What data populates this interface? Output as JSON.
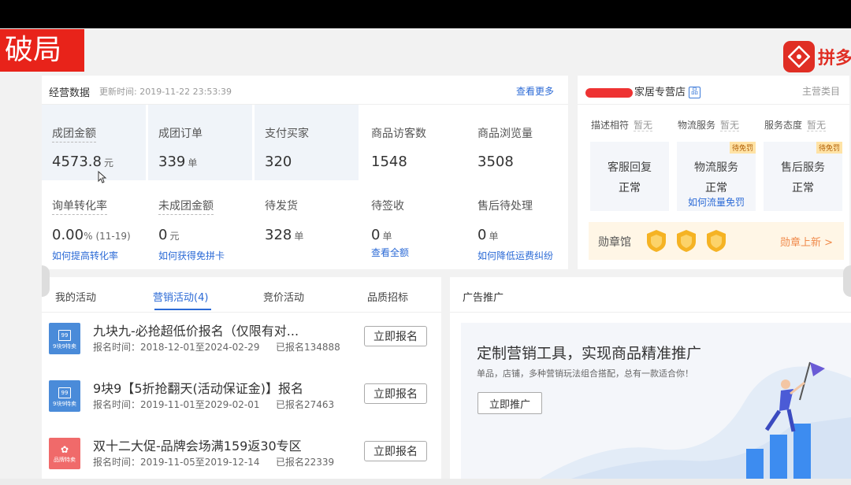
{
  "brand": {
    "label": "破局"
  },
  "logo": {
    "text": "拼多"
  },
  "ops": {
    "title": "经营数据",
    "updated": "更新时间: 2019-11-22 23:53:39",
    "more": "查看更多",
    "row1": [
      {
        "label": "成团金额",
        "value": "4573.8",
        "unit": "元"
      },
      {
        "label": "成团订单",
        "value": "339",
        "unit": "单"
      },
      {
        "label": "支付买家",
        "value": "320",
        "unit": ""
      },
      {
        "label": "商品访客数",
        "value": "1548",
        "unit": ""
      },
      {
        "label": "商品浏览量",
        "value": "3508",
        "unit": ""
      }
    ],
    "row2": [
      {
        "label": "询单转化率",
        "value": "0.00",
        "unit": "%",
        "extra": "(11-19)",
        "link": "如何提高转化率"
      },
      {
        "label": "未成团金额",
        "value": "0",
        "unit": "元",
        "link": "如何获得免拼卡"
      },
      {
        "label": "待发货",
        "value": "328",
        "unit": "单",
        "link": ""
      },
      {
        "label": "待签收",
        "value": "0",
        "unit": "单",
        "link": "查看全额"
      },
      {
        "label": "售后待处理",
        "value": "0",
        "unit": "单",
        "link": "如何降低运费纠纷"
      }
    ]
  },
  "shop": {
    "name": "家居专营店",
    "category": "主营类目",
    "scores": [
      {
        "label": "描述相符",
        "value": "暂无"
      },
      {
        "label": "物流服务",
        "value": "暂无"
      },
      {
        "label": "服务态度",
        "value": "暂无"
      }
    ],
    "services": [
      {
        "label": "客服回复",
        "status": "正常",
        "tag": "",
        "link": ""
      },
      {
        "label": "物流服务",
        "status": "正常",
        "tag": "待免罚",
        "link": "如何流量免罚"
      },
      {
        "label": "售后服务",
        "status": "正常",
        "tag": "待免罚",
        "link": ""
      }
    ],
    "medals": {
      "label": "勋章馆",
      "new": "勋章上新 >"
    }
  },
  "activities": {
    "tabs": [
      "我的活动",
      "营销活动(4)",
      "竞价活动",
      "品质招标"
    ],
    "active_tab": 1,
    "items": [
      {
        "icon_text": "9块9特卖",
        "icon_color": "#4a8bd9",
        "title": "九块九-必抢超低价报名（仅限有对...",
        "time": "报名时间：2018-12-01至2024-02-29",
        "count": "已报名134888",
        "button": "立即报名"
      },
      {
        "icon_text": "9块9特卖",
        "icon_color": "#4a8bd9",
        "title": "9块9【5折抢翻天(活动保证金)】报名",
        "time": "报名时间：2019-11-01至2029-02-01",
        "count": "已报名27463",
        "button": "立即报名"
      },
      {
        "icon_text": "品牌特卖",
        "icon_color": "#f06a6a",
        "title": "双十二大促-品牌会场满159返30专区",
        "time": "报名时间：2019-11-05至2019-12-14",
        "count": "已报名22339",
        "button": "立即报名"
      }
    ]
  },
  "ads": {
    "title": "广告推广",
    "headline": "定制营销工具，实现商品精准推广",
    "subtitle": "单品，店铺，多种营销玩法组合搭配，总有一款适合你！",
    "button": "立即推广"
  },
  "colors": {
    "accent": "#2b6ad6",
    "brand_red": "#e8231a",
    "pdd_red": "#e02e24",
    "medal": "#f5b324"
  }
}
